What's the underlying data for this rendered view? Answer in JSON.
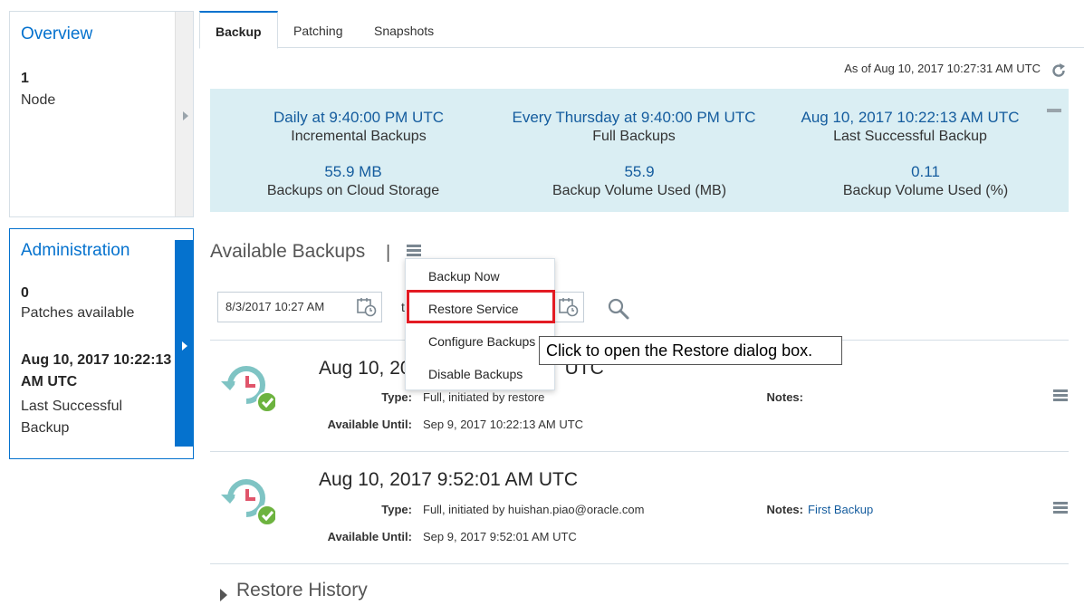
{
  "overview": {
    "title": "Overview",
    "count": "1",
    "label": "Node"
  },
  "administration": {
    "title": "Administration",
    "count": "0",
    "label": "Patches available",
    "last_date_line1": "Aug 10, 2017 10:22:13",
    "last_date_line2": "AM UTC",
    "last_label_line1": "Last Successful",
    "last_label_line2": "Backup"
  },
  "tabs": [
    {
      "label": "Backup",
      "active": true
    },
    {
      "label": "Patching"
    },
    {
      "label": "Snapshots"
    }
  ],
  "as_of": "As of Aug 10, 2017 10:27:31 AM UTC",
  "summary": {
    "incremental_value": "Daily at 9:40:00 PM UTC",
    "incremental_label": "Incremental Backups",
    "full_value": "Every Thursday at 9:40:00 PM UTC",
    "full_label": "Full Backups",
    "last_value": "Aug 10, 2017 10:22:13 AM UTC",
    "last_label": "Last Successful Backup",
    "cloud_value": "55.9 MB",
    "cloud_label": "Backups on Cloud Storage",
    "volume_mb_value": "55.9",
    "volume_mb_label": "Backup Volume Used (MB)",
    "volume_pct_value": "0.11",
    "volume_pct_label": "Backup Volume Used (%)"
  },
  "available_backups": {
    "title": "Available Backups",
    "separator": "|",
    "from_date": "8/3/2017 10:27 AM",
    "to_label": "to"
  },
  "menu": {
    "items": [
      "Backup Now",
      "Restore Service",
      "Configure Backups",
      "Disable Backups"
    ]
  },
  "tooltip": "Click to open the Restore dialog box.",
  "backups": [
    {
      "title": "Aug 10, 2017 10:22:13 AM UTC",
      "title_visible_left": "Aug 10, 20",
      "title_visible_right": "UTC",
      "type_label": "Type:",
      "type_value": "Full, initiated by restore",
      "notes_label": "Notes:",
      "notes_value": "",
      "until_label": "Available Until:",
      "until_value": "Sep 9, 2017 10:22:13 AM UTC"
    },
    {
      "title": "Aug 10, 2017 9:52:01 AM UTC",
      "type_label": "Type:",
      "type_value": "Full, initiated by huishan.piao@oracle.com",
      "notes_label": "Notes:",
      "notes_value": "First Backup",
      "until_label": "Available Until:",
      "until_value": "Sep 9, 2017 9:52:01 AM UTC"
    }
  ],
  "restore_history": {
    "title": "Restore History"
  },
  "colors": {
    "accent": "#0572ce",
    "summary_bg": "#daeef3",
    "highlight_border": "#e31b23",
    "success_green": "#6db33f",
    "clock_teal": "#7fc4c4",
    "clock_hand": "#e0556b"
  },
  "icons": [
    "refresh-icon",
    "minus-icon",
    "hamburger-menu-icon",
    "calendar-icon",
    "search-icon",
    "backup-clock-check-icon",
    "chevron-right-icon",
    "triangle-right-icon"
  ]
}
